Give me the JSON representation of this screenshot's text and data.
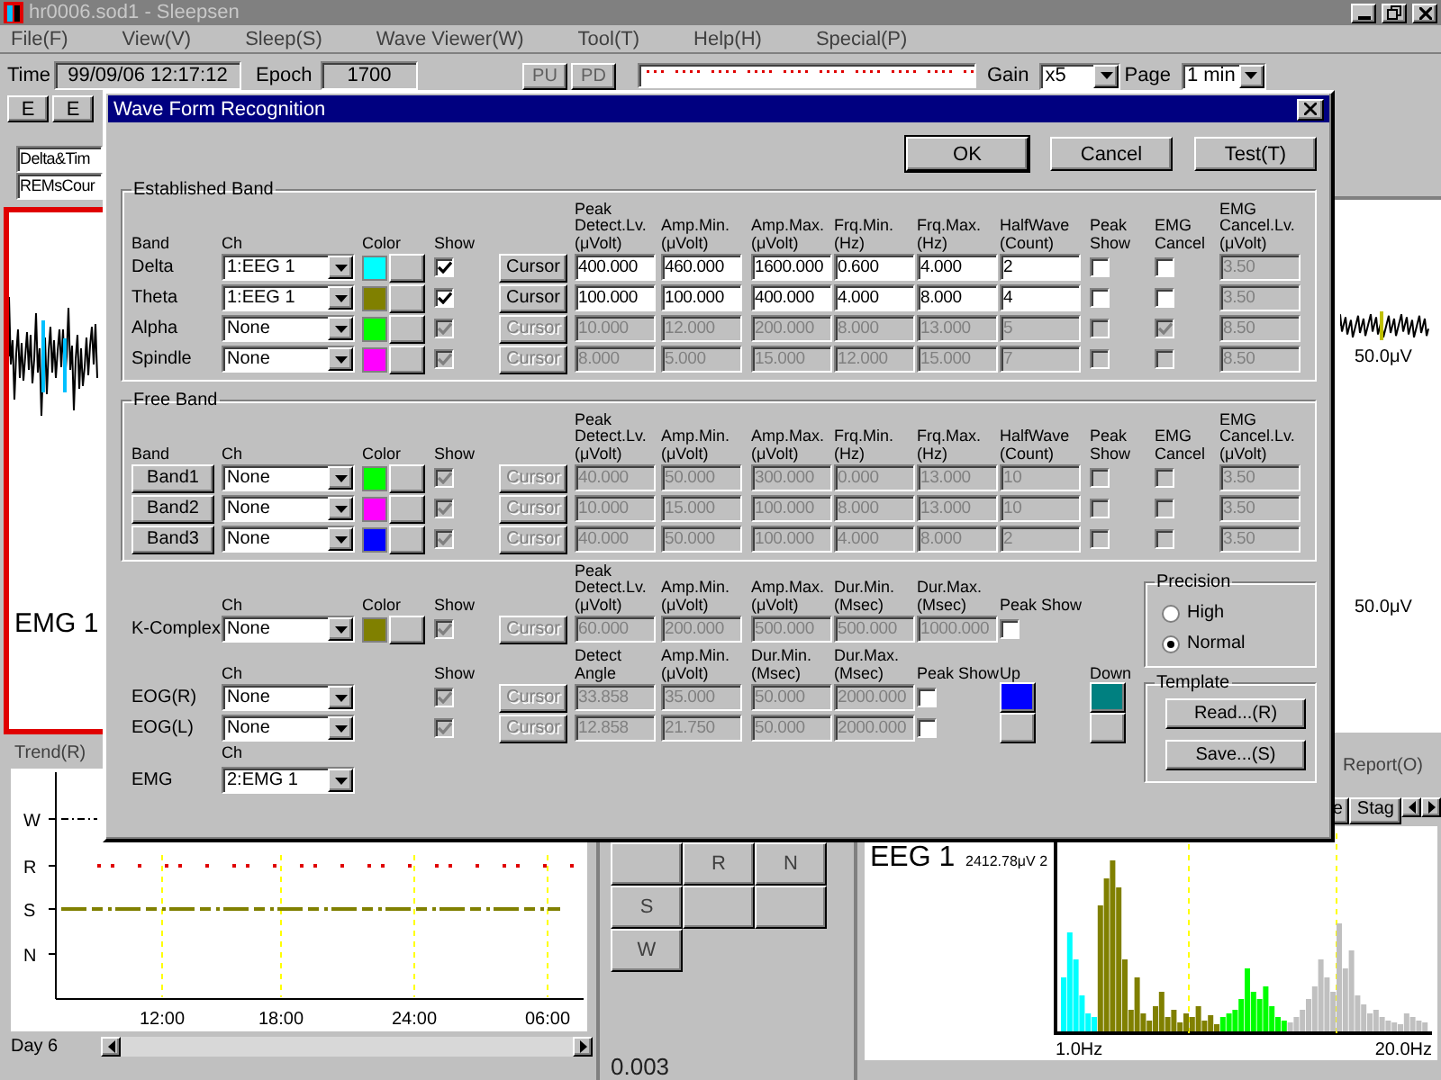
{
  "app": {
    "title": "hr0006.sod1 - Sleepsen",
    "menu": [
      "File(F)",
      "View(V)",
      "Sleep(S)",
      "Wave Viewer(W)",
      "Tool(T)",
      "Help(H)",
      "Special(P)"
    ],
    "toolbar": {
      "time_label": "Time",
      "time": "99/09/06 12:17:12",
      "epoch_label": "Epoch",
      "epoch": "1700",
      "buttons": [
        "PU",
        "PD"
      ],
      "gain_label": "Gain",
      "gain": "x5",
      "page_label": "Page",
      "page": "1 min"
    },
    "toolbar2_buttons": [
      "E",
      "E"
    ],
    "left_fields": [
      "Delta&Tim",
      "REMsCour"
    ],
    "left_wave_label": "EMG 1",
    "right_wave_labels": [
      "50.0μV",
      "50.0μV"
    ]
  },
  "trend": {
    "tab": "Trend(R)",
    "y_labels": [
      "W",
      "R",
      "S",
      "N"
    ],
    "x_labels": [
      "12:00",
      "18:00",
      "24:00",
      "06:00"
    ],
    "day": "Day 6"
  },
  "stage_buttons": [
    {
      "kind": "empty"
    },
    {
      "kind": "stage",
      "label": "R"
    },
    {
      "kind": "stage",
      "label": "N"
    },
    {
      "kind": "stage",
      "label": "S"
    },
    {
      "kind": "empty"
    },
    {
      "kind": "empty"
    },
    {
      "kind": "stage",
      "label": "W"
    }
  ],
  "stage_value": "0.003",
  "spectrum": {
    "report_tab": "Report(O)",
    "tabs": [
      "e",
      "Stag"
    ],
    "channel": "EEG 1",
    "amplitude": "2412.78μV 2",
    "x_min": "1.0Hz",
    "x_max": "20.0Hz"
  },
  "dialog": {
    "title": "Wave Form Recognition",
    "buttons": [
      {
        "label": "OK",
        "default": true
      },
      {
        "label": "Cancel",
        "default": false
      },
      {
        "label": "Test(T)",
        "default": false
      }
    ],
    "established_band": {
      "title": "Established Band",
      "kind": "established",
      "headers": [
        "Band",
        "Ch",
        "Color",
        "Show",
        "Peak Detect.Lv. (μVolt)",
        "Amp.Min. (μVolt)",
        "Amp.Max. (μVolt)",
        "Frq.Min. (Hz)",
        "Frq.Max. (Hz)",
        "HalfWave (Count)",
        "Peak Show",
        "EMG Cancel",
        "EMG Cancel.Lv. (μVolt)"
      ],
      "rows": [
        {
          "band": "Delta",
          "ch": "1:EEG 1",
          "color": "#00ffff",
          "show": true,
          "enabled": true,
          "cursor": "Cursor",
          "values": [
            "400.000",
            "460.000",
            "1600.000",
            "0.600",
            "4.000",
            "2"
          ],
          "peak_show": false,
          "emg_cancel": false,
          "emg_cancel_level": "3.50"
        },
        {
          "band": "Theta",
          "ch": "1:EEG 1",
          "color": "#808000",
          "show": true,
          "enabled": true,
          "cursor": "Cursor",
          "values": [
            "100.000",
            "100.000",
            "400.000",
            "4.000",
            "8.000",
            "4"
          ],
          "peak_show": false,
          "emg_cancel": false,
          "emg_cancel_level": "3.50"
        },
        {
          "band": "Alpha",
          "ch": "None",
          "color": "#00ff00",
          "show": true,
          "enabled": false,
          "cursor": "Cursor",
          "values": [
            "10.000",
            "12.000",
            "200.000",
            "8.000",
            "13.000",
            "5"
          ],
          "peak_show": false,
          "emg_cancel": true,
          "emg_cancel_level": "8.50"
        },
        {
          "band": "Spindle",
          "ch": "None",
          "color": "#ff00ff",
          "show": true,
          "enabled": false,
          "cursor": "Cursor",
          "values": [
            "8.000",
            "5.000",
            "15.000",
            "12.000",
            "15.000",
            "7"
          ],
          "peak_show": false,
          "emg_cancel": false,
          "emg_cancel_level": "8.50"
        }
      ]
    },
    "free_band": {
      "title": "Free Band",
      "kind": "free",
      "headers": [
        "Band",
        "Ch",
        "Color",
        "Show",
        "Peak Detect.Lv. (μVolt)",
        "Amp.Min. (μVolt)",
        "Amp.Max. (μVolt)",
        "Frq.Min. (Hz)",
        "Frq.Max. (Hz)",
        "HalfWave (Count)",
        "Peak Show",
        "EMG Cancel",
        "EMG Cancel.Lv. (μVolt)"
      ],
      "rows": [
        {
          "band": "Band1",
          "ch": "None",
          "color": "#00ff00",
          "show": true,
          "enabled": false,
          "cursor": "Cursor",
          "values": [
            "40.000",
            "50.000",
            "300.000",
            "0.000",
            "13.000",
            "10"
          ],
          "peak_show": false,
          "emg_cancel": false,
          "emg_cancel_level": "3.50"
        },
        {
          "band": "Band2",
          "ch": "None",
          "color": "#ff00ff",
          "show": true,
          "enabled": false,
          "cursor": "Cursor",
          "values": [
            "10.000",
            "15.000",
            "100.000",
            "8.000",
            "13.000",
            "10"
          ],
          "peak_show": false,
          "emg_cancel": false,
          "emg_cancel_level": "3.50"
        },
        {
          "band": "Band3",
          "ch": "None",
          "color": "#0000ff",
          "show": true,
          "enabled": false,
          "cursor": "Cursor",
          "values": [
            "40.000",
            "50.000",
            "100.000",
            "4.000",
            "8.000",
            "2"
          ],
          "peak_show": false,
          "emg_cancel": false,
          "emg_cancel_level": "3.50"
        }
      ]
    },
    "k_complex": {
      "headers": [
        "Ch",
        "Color",
        "Show",
        "Peak Detect.Lv. (μVolt)",
        "Amp.Min. (μVolt)",
        "Amp.Max. (μVolt)",
        "Dur.Min. (Msec)",
        "Dur.Max. (Msec)",
        "Peak Show"
      ],
      "row": {
        "label": "K-Complex",
        "ch": "None",
        "color": "#808000",
        "show": true,
        "enabled": false,
        "cursor": "Cursor",
        "values": [
          "60.000",
          "200.000",
          "500.000",
          "500.000",
          "1000.000"
        ],
        "peak_show": false
      }
    },
    "eog": {
      "headers": [
        "Ch",
        "Show",
        "Detect Angle",
        "Amp.Min. (μVolt)",
        "Dur.Min. (Msec)",
        "Dur.Max. (Msec)",
        "Peak Show",
        "Up",
        "Down"
      ],
      "rows": [
        {
          "label": "EOG(R)",
          "ch": "None",
          "show": true,
          "enabled": false,
          "cursor": "Cursor",
          "values": [
            "33.858",
            "35.000",
            "50.000",
            "2000.000"
          ],
          "peak_show": false,
          "up": {
            "color": "#0000ff"
          },
          "down": {
            "color": "#008080"
          }
        },
        {
          "label": "EOG(L)",
          "ch": "None",
          "show": true,
          "enabled": false,
          "cursor": "Cursor",
          "values": [
            "12.858",
            "21.750",
            "50.000",
            "2000.000"
          ],
          "peak_show": false
        }
      ]
    },
    "emg": {
      "header": "Ch",
      "label": "EMG",
      "ch": "2:EMG 1"
    },
    "precision": {
      "title": "Precision",
      "options": [
        {
          "label": "High",
          "selected": false
        },
        {
          "label": "Normal",
          "selected": true
        }
      ]
    },
    "template": {
      "title": "Template",
      "buttons": [
        "Read...(R)",
        "Save...(S)"
      ]
    }
  }
}
